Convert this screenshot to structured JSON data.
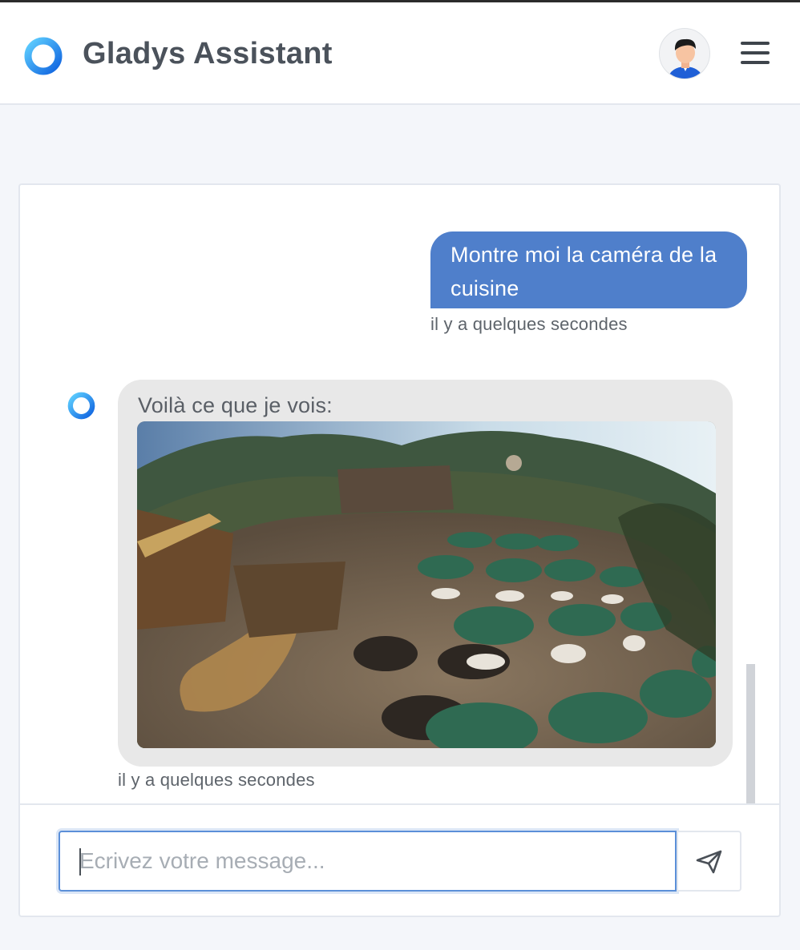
{
  "app": {
    "title": "Gladys Assistant"
  },
  "icons": {
    "logo": "gladys-ring-logo-icon",
    "user_avatar": "user-avatar-icon",
    "menu": "hamburger-menu-icon",
    "bot_avatar": "gladys-ring-logo-icon",
    "send": "paper-plane-send-icon"
  },
  "colors": {
    "accent": "#4f7fcb",
    "logo_blue": "#1f8cf0",
    "bot_bubble": "#e8e8e8",
    "background": "#f4f6fa"
  },
  "chat": {
    "messages": [
      {
        "sender": "user",
        "text": "Montre moi la caméra de la cuisine",
        "time": "il y a quelques secondes"
      },
      {
        "sender": "bot",
        "text": "Voilà ce que je vois:",
        "attachment": "camera-image",
        "time": "il y a quelques secondes"
      }
    ]
  },
  "composer": {
    "placeholder": "Ecrivez votre message...",
    "value": ""
  }
}
